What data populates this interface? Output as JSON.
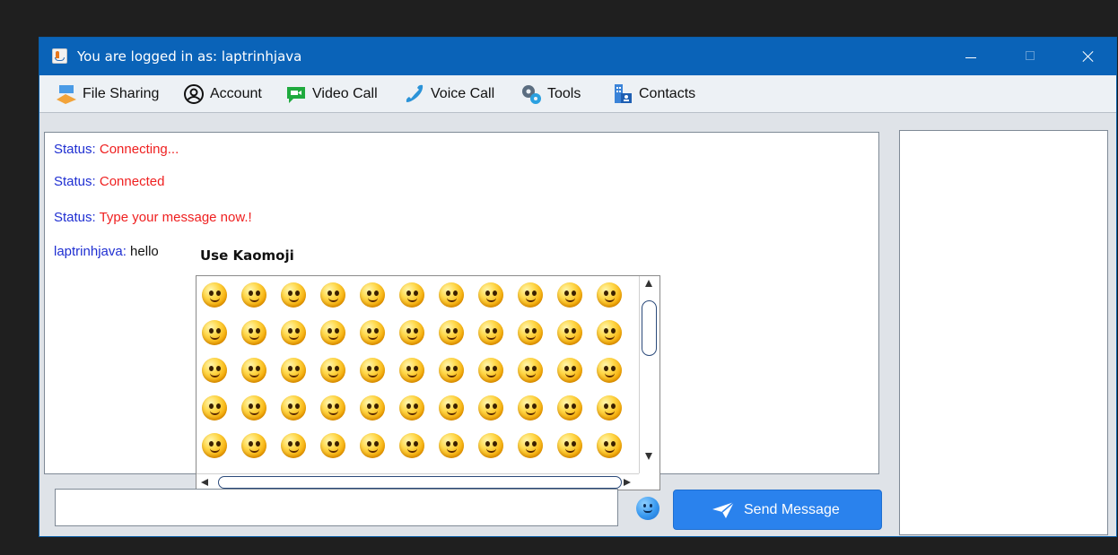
{
  "window": {
    "title": "You are logged in as: laptrinhjava",
    "controls": [
      "minimize-icon",
      "maximize-icon",
      "close-icon"
    ]
  },
  "menu": {
    "items": [
      {
        "label": "File Sharing",
        "icon": "file-sharing-icon"
      },
      {
        "label": "Account",
        "icon": "account-icon"
      },
      {
        "label": "Video Call",
        "icon": "video-call-icon"
      },
      {
        "label": "Voice Call",
        "icon": "phone-icon"
      },
      {
        "label": "Tools",
        "icon": "gears-icon"
      },
      {
        "label": "Contacts",
        "icon": "contacts-icon"
      }
    ]
  },
  "chat": {
    "lines": [
      {
        "sender": "Status:",
        "text": " Connecting..."
      },
      {
        "sender": "Status:",
        "text": " Connected"
      },
      {
        "sender": "Status:",
        "text": " Type your message now.!"
      },
      {
        "sender": "laptrinhjava:",
        "text": " hello"
      }
    ]
  },
  "kaomoji": {
    "title": "Use Kaomoji",
    "rows": 5,
    "columns": 11,
    "icon": "emoticon-face-icon"
  },
  "compose": {
    "input_value": "",
    "emoji_button_icon": "smiley-icon",
    "send_label": "Send Message",
    "send_icon": "paper-plane-icon"
  },
  "colors": {
    "titlebar": "#0a63b8",
    "sender": "#1f2fd2",
    "status_text": "#ef2020",
    "send_button": "#2a82ed"
  }
}
